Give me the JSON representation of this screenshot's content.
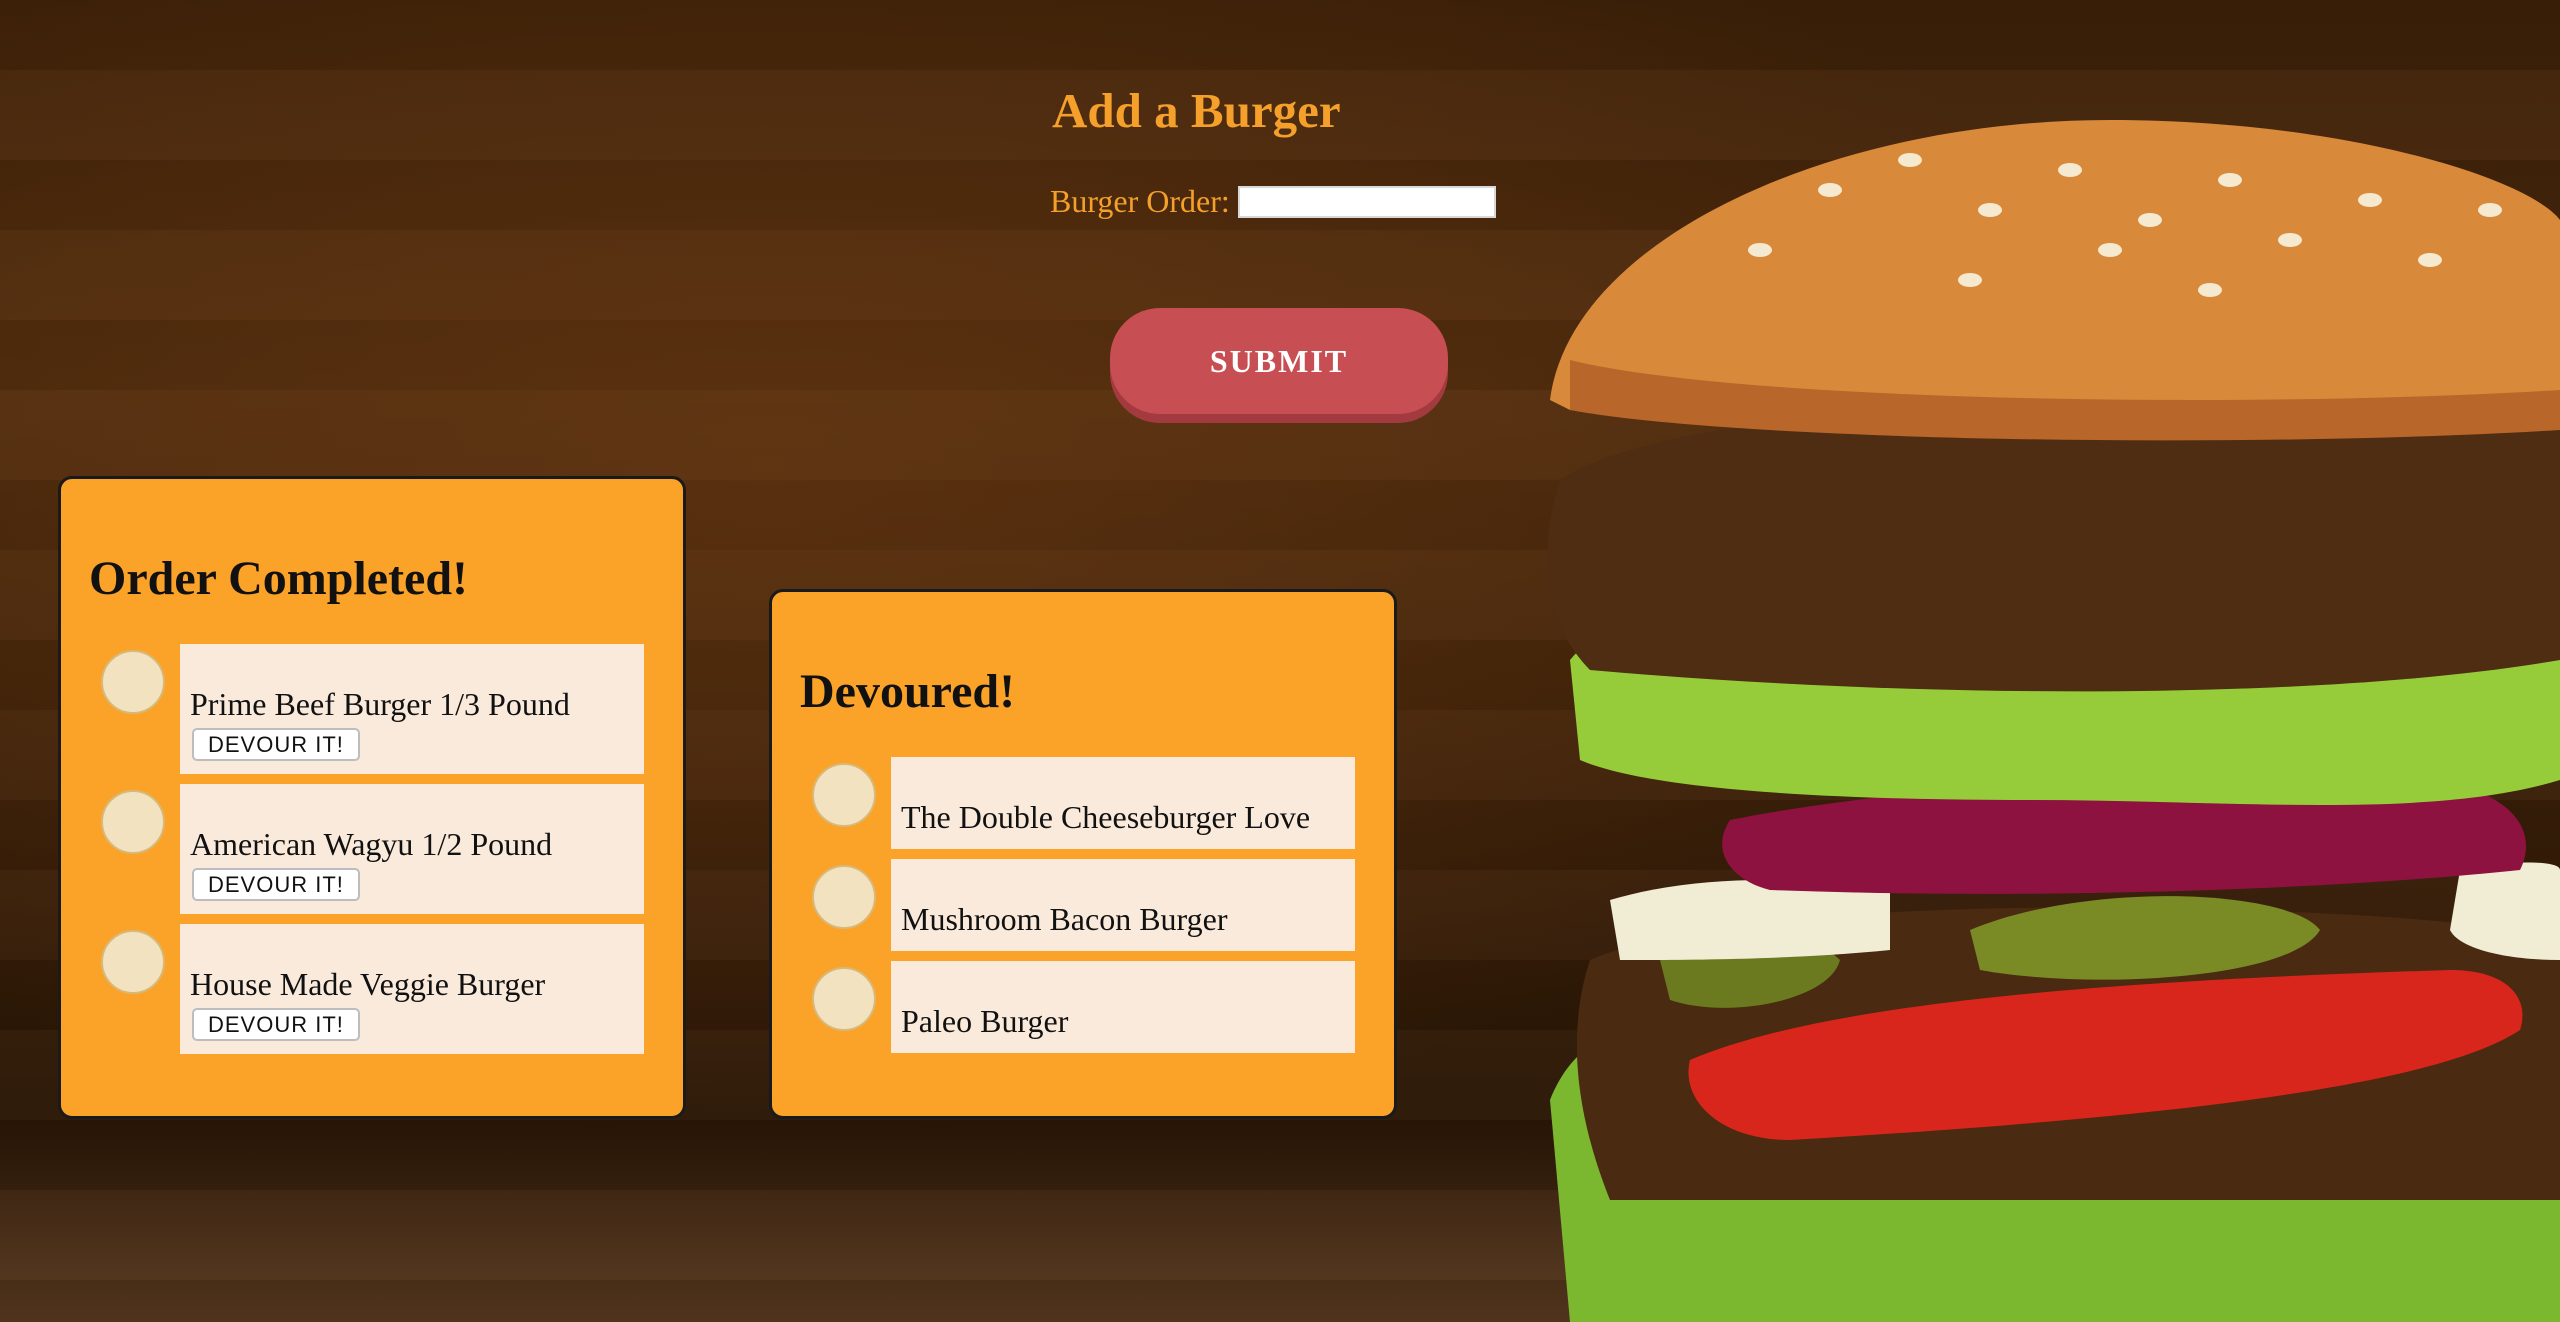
{
  "form": {
    "title": "Add a Burger",
    "order_label": "Burger Order:",
    "order_value": "",
    "submit_label": "SUBMIT"
  },
  "completed": {
    "title": "Order Completed!",
    "items": [
      {
        "name": "Prime Beef Burger 1/3 Pound",
        "action": "DEVOUR IT!"
      },
      {
        "name": "American Wagyu 1/2 Pound",
        "action": "DEVOUR IT!"
      },
      {
        "name": "House Made Veggie Burger",
        "action": "DEVOUR IT!"
      }
    ]
  },
  "devoured": {
    "title": "Devoured!",
    "items": [
      {
        "name": "The Double Cheeseburger Love"
      },
      {
        "name": "Mushroom Bacon Burger"
      },
      {
        "name": "Paleo Burger"
      }
    ]
  },
  "colors": {
    "accent": "#f4a02a",
    "panel": "#fba229",
    "card": "#faeadb",
    "submit": "#c74e52"
  },
  "icons": {
    "item_icon": "burger-icon",
    "background_art": "burger-photo"
  }
}
